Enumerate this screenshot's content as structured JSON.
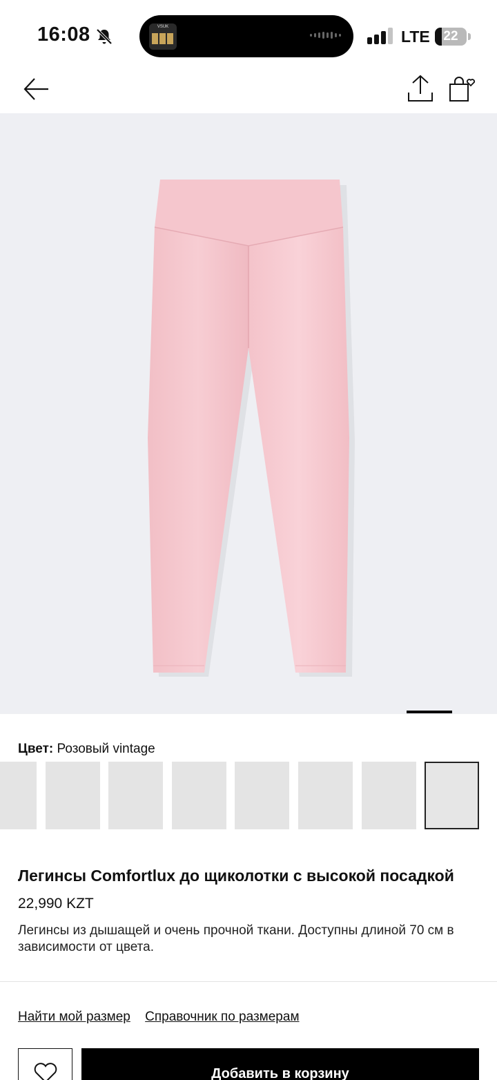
{
  "status_bar": {
    "time": "16:08",
    "island_thumb_label": "VSUK",
    "network": "LTE",
    "battery": "22",
    "battery_fraction": 0.22
  },
  "nav": {
    "back_icon": "arrow-left-icon",
    "share_icon": "share-upload-icon",
    "bag_icon": "shopping-bag-heart-icon"
  },
  "gallery": {
    "image_description_icon": "leggings-image",
    "product_color_hex": "#f6c8cf"
  },
  "color": {
    "label": "Цвет:",
    "value": " Розовый vintage",
    "swatch_count": 8,
    "selected_index": 7
  },
  "product": {
    "title": "Легинсы Comfortlux до щиколотки с высокой посадкой",
    "price": "22,990 KZT",
    "description": "Легинсы из дышащей и очень прочной ткани. Доступны длиной 70 см в зависимости от цвета."
  },
  "links": {
    "find_size": "Найти мой размер",
    "size_guide": "Справочник по размерам"
  },
  "actions": {
    "favorite_icon": "heart-icon",
    "add_to_cart": "Добавить в корзину"
  }
}
